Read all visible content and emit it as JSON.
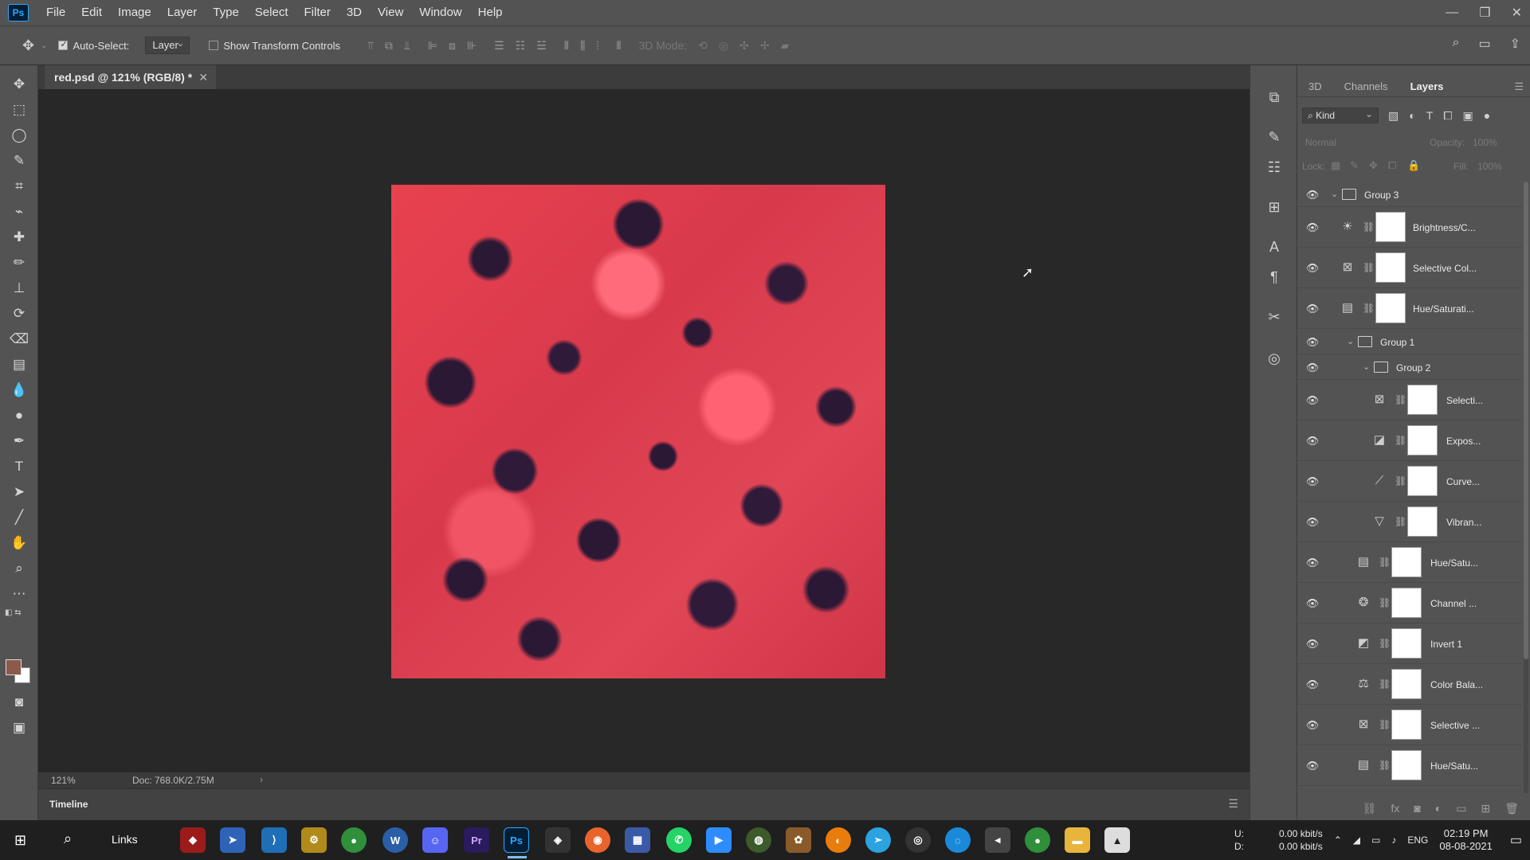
{
  "app": {
    "logo": "Ps",
    "window_controls": [
      "minimize-icon",
      "restore-icon",
      "close-icon"
    ]
  },
  "menu": [
    "File",
    "Edit",
    "Image",
    "Layer",
    "Type",
    "Select",
    "Filter",
    "3D",
    "View",
    "Window",
    "Help"
  ],
  "options": {
    "tool_icon": "move-icon",
    "auto_select_label": "Auto-Select:",
    "auto_select_checked": true,
    "auto_select_target": "Layer",
    "show_transform_label": "Show Transform Controls",
    "show_transform_checked": false
  },
  "document": {
    "tab_title": "red.psd @ 121% (RGB/8) *",
    "zoom": "121%",
    "doc_info": "Doc: 768.0K/2.75M",
    "timeline_label": "Timeline"
  },
  "tools": [
    "move-tool",
    "marquee-tool",
    "lasso-tool",
    "quick-select-tool",
    "crop-tool",
    "eyedropper-tool",
    "healing-brush-tool",
    "brush-tool",
    "clone-stamp-tool",
    "history-brush-tool",
    "eraser-tool",
    "gradient-tool",
    "blur-tool",
    "dodge-tool",
    "pen-tool",
    "type-tool",
    "path-select-tool",
    "line-tool",
    "hand-tool",
    "zoom-tool",
    "more-tools"
  ],
  "colors": {
    "foreground": "#8b5a4a",
    "background": "#ffffff",
    "accent": "#31a8ff"
  },
  "panel": {
    "tabs": [
      "3D",
      "Channels",
      "Layers"
    ],
    "active_tab": "Layers",
    "filter_kind": "Kind",
    "blend_mode": "Normal",
    "opacity_label": "Opacity:",
    "opacity_value": "100%",
    "lock_label": "Lock:",
    "fill_label": "Fill:",
    "fill_value": "100%"
  },
  "layers": [
    {
      "name": "Group 3",
      "type": "group",
      "icon": "folder-icon"
    },
    {
      "name": "Brightness/C...",
      "type": "adjustment",
      "icon": "brightness-icon"
    },
    {
      "name": "Selective Col...",
      "type": "adjustment",
      "icon": "selective-color-icon"
    },
    {
      "name": "Hue/Saturati...",
      "type": "adjustment",
      "icon": "hue-saturation-icon"
    },
    {
      "name": "Group 1",
      "type": "group",
      "icon": "folder-icon"
    },
    {
      "name": "Group 2",
      "type": "group",
      "icon": "folder-icon"
    },
    {
      "name": "Selecti...",
      "type": "adjustment",
      "icon": "selective-color-icon"
    },
    {
      "name": "Expos...",
      "type": "adjustment",
      "icon": "exposure-icon"
    },
    {
      "name": "Curve...",
      "type": "adjustment",
      "icon": "curves-icon"
    },
    {
      "name": "Vibran...",
      "type": "adjustment",
      "icon": "vibrance-icon"
    },
    {
      "name": "Hue/Satu...",
      "type": "adjustment",
      "icon": "hue-saturation-icon"
    },
    {
      "name": "Channel ...",
      "type": "adjustment",
      "icon": "channel-mixer-icon"
    },
    {
      "name": "Invert 1",
      "type": "adjustment",
      "icon": "invert-icon"
    },
    {
      "name": "Color Bala...",
      "type": "adjustment",
      "icon": "color-balance-icon"
    },
    {
      "name": "Selective ...",
      "type": "adjustment",
      "icon": "selective-color-icon"
    },
    {
      "name": "Hue/Satu...",
      "type": "adjustment",
      "icon": "hue-saturation-icon"
    }
  ],
  "taskbar": {
    "search_label": "Links",
    "apps": [
      "windows-start-icon",
      "search-icon",
      "links-toolbar",
      "red-app-icon",
      "blue-arrow-icon",
      "vscode-icon",
      "yellow-tool-icon",
      "chrome-icon",
      "w-app-icon",
      "discord-icon",
      "premiere-pro-icon",
      "photoshop-icon",
      "git-icon",
      "firefox-icon",
      "notion-icon",
      "whatsapp-icon",
      "zoom-icon",
      "game-icon",
      "palette-icon",
      "blender-icon",
      "telegram-icon",
      "obs-icon",
      "circle-app-icon",
      "vpn-icon",
      "chrome-icon-2",
      "file-explorer-icon",
      "photos-icon"
    ],
    "net_label": "U:\nD:",
    "net_up": "0.00 kbit/s",
    "net_down": "0.00 kbit/s",
    "lang": "ENG",
    "time": "02:19 PM",
    "date": "08-08-2021"
  }
}
